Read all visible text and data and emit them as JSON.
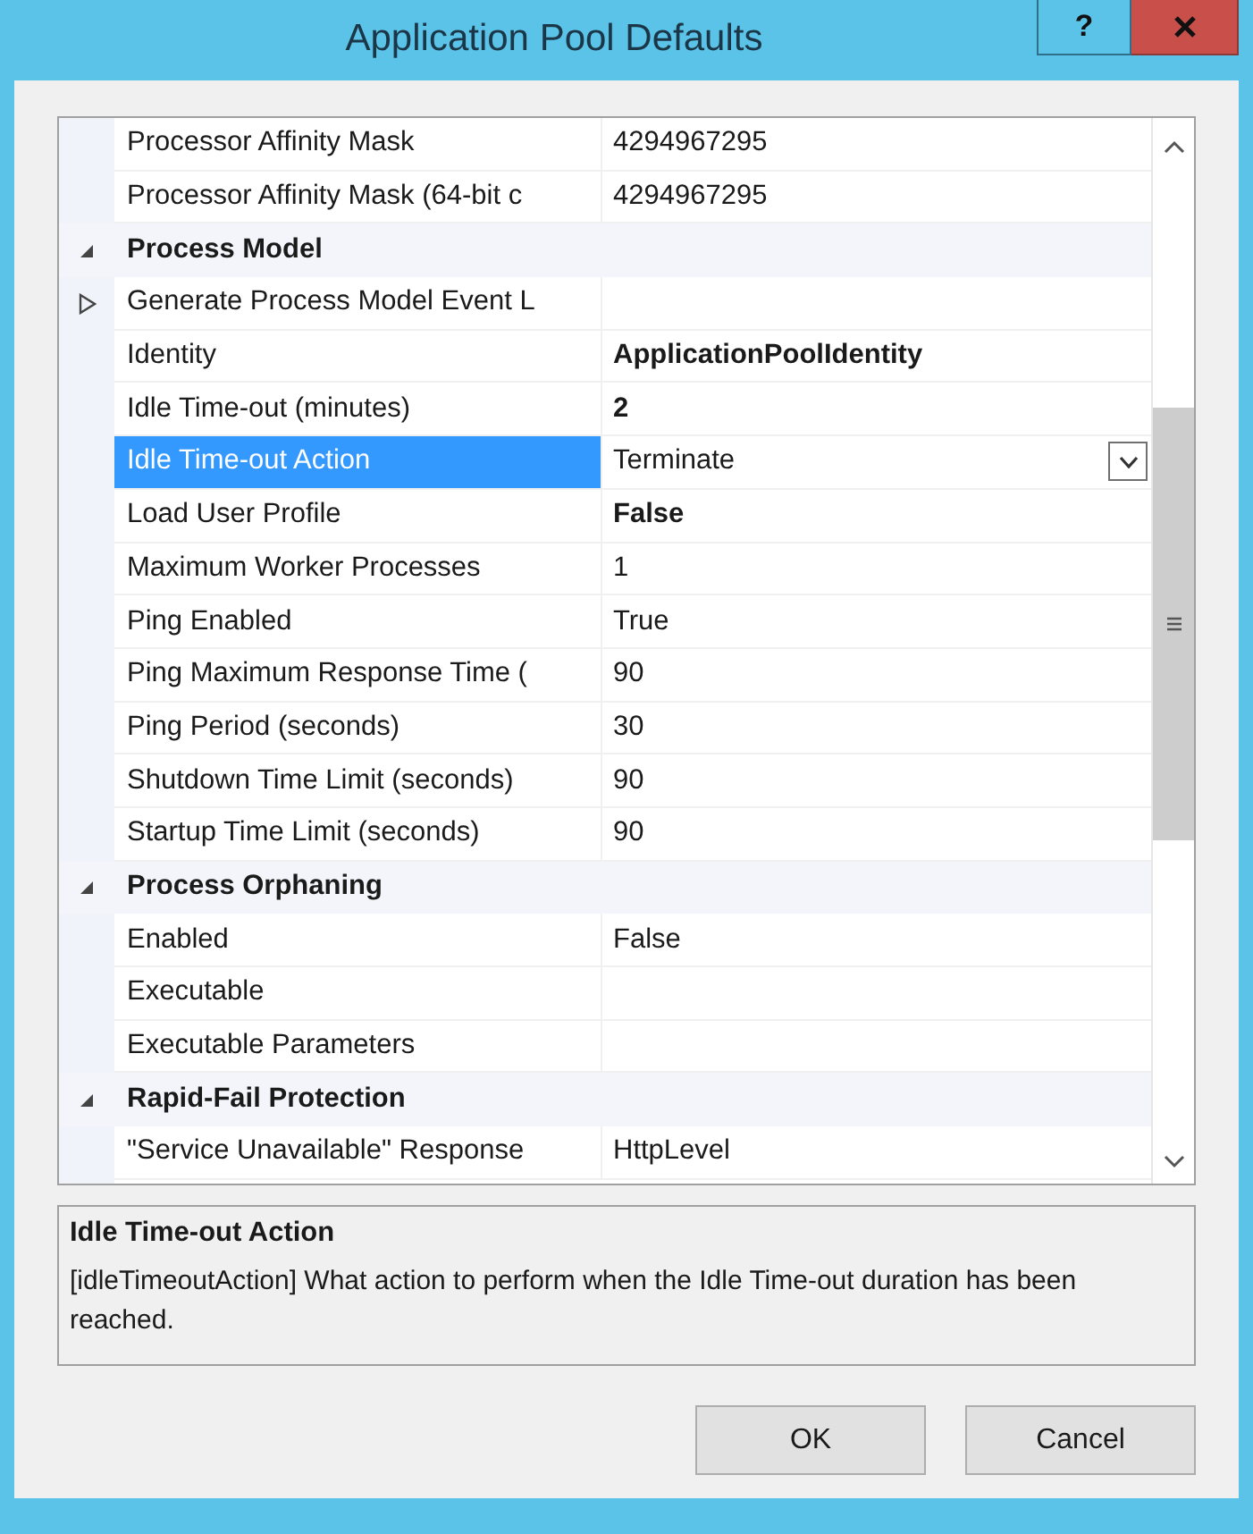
{
  "window": {
    "title": "Application Pool Defaults",
    "help_button": "?"
  },
  "properties": [
    {
      "kind": "property",
      "name": "Processor Affinity Mask",
      "value": "4294967295",
      "selected": false
    },
    {
      "kind": "property",
      "name": "Processor Affinity Mask (64-bit c",
      "value": "4294967295",
      "selected": false
    },
    {
      "kind": "category",
      "name": "Process Model",
      "expanded": true
    },
    {
      "kind": "property",
      "name": "Generate Process Model Event L",
      "expanded": false,
      "selected": false
    },
    {
      "kind": "property",
      "name": "Identity",
      "value": "ApplicationPoolIdentity",
      "bold": true,
      "selected": false
    },
    {
      "kind": "property",
      "name": "Idle Time-out (minutes)",
      "value": "2",
      "bold": true,
      "selected": false
    },
    {
      "kind": "property",
      "name": "Idle Time-out Action",
      "value": "Terminate",
      "selected": true,
      "dropdown": true
    },
    {
      "kind": "property",
      "name": "Load User Profile",
      "value": "False",
      "bold": true,
      "selected": false
    },
    {
      "kind": "property",
      "name": "Maximum Worker Processes",
      "value": "1",
      "selected": false
    },
    {
      "kind": "property",
      "name": "Ping Enabled",
      "value": "True",
      "selected": false
    },
    {
      "kind": "property",
      "name": "Ping Maximum Response Time (",
      "value": "90",
      "selected": false
    },
    {
      "kind": "property",
      "name": "Ping Period (seconds)",
      "value": "30",
      "selected": false
    },
    {
      "kind": "property",
      "name": "Shutdown Time Limit (seconds)",
      "value": "90",
      "selected": false
    },
    {
      "kind": "property",
      "name": "Startup Time Limit (seconds)",
      "value": "90",
      "selected": false
    },
    {
      "kind": "category",
      "name": "Process Orphaning",
      "expanded": true
    },
    {
      "kind": "property",
      "name": "Enabled",
      "value": "False",
      "selected": false
    },
    {
      "kind": "property",
      "name": "Executable",
      "selected": false
    },
    {
      "kind": "property",
      "name": "Executable Parameters",
      "selected": false
    },
    {
      "kind": "category",
      "name": "Rapid-Fail Protection",
      "expanded": true
    },
    {
      "kind": "property",
      "name": "\"Service Unavailable\" Response",
      "value": "HttpLevel",
      "selected": false
    }
  ],
  "description": {
    "title": "Idle Time-out Action",
    "text": "[idleTimeoutAction] What action to perform when the Idle Time-out duration has been reached."
  },
  "buttons": [
    "OK",
    "Cancel"
  ]
}
